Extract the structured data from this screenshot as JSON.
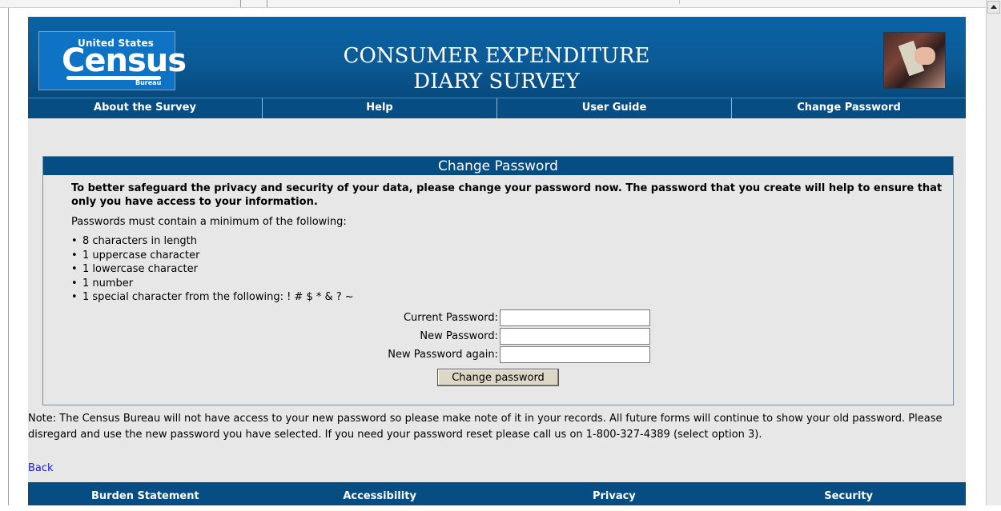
{
  "header": {
    "logo": {
      "top": "United States",
      "main": "Census",
      "sub": "Bureau"
    },
    "title_line1": "CONSUMER EXPENDITURE",
    "title_line2": "DIARY SURVEY"
  },
  "nav": {
    "items": [
      "About the Survey",
      "Help",
      "User Guide",
      "Change Password"
    ]
  },
  "form": {
    "heading": "Change Password",
    "intro": "To better safeguard the privacy and security of your data, please change your password now. The password that you create will help to ensure that only you have access to your information.",
    "requirements_intro": "Passwords must contain a minimum of the following:",
    "requirements": [
      "8 characters in length",
      "1 uppercase character",
      "1 lowercase character",
      "1 number",
      "1 special character from the following: ! # $ * & ? ~"
    ],
    "fields": {
      "current_label": "Current Password:",
      "current_value": "",
      "new_label": "New Password:",
      "new_value": "",
      "again_label": "New Password again:",
      "again_value": ""
    },
    "submit_label": "Change password"
  },
  "note": "Note: The Census Bureau will not have access to your new password so please make note of it in your records. All future forms will continue to show your old password. Please disregard and use the new password you have selected. If you need your password reset please call us on 1-800-327-4389 (select option 3).",
  "back_label": "Back",
  "footer": {
    "items": [
      "Burden Statement",
      "Accessibility",
      "Privacy",
      "Security"
    ]
  },
  "colors": {
    "header_blue": "#0b5b97",
    "nav_blue": "#064d84",
    "page_bg": "#e7e7e7",
    "link_blue": "#1a1ae0"
  }
}
